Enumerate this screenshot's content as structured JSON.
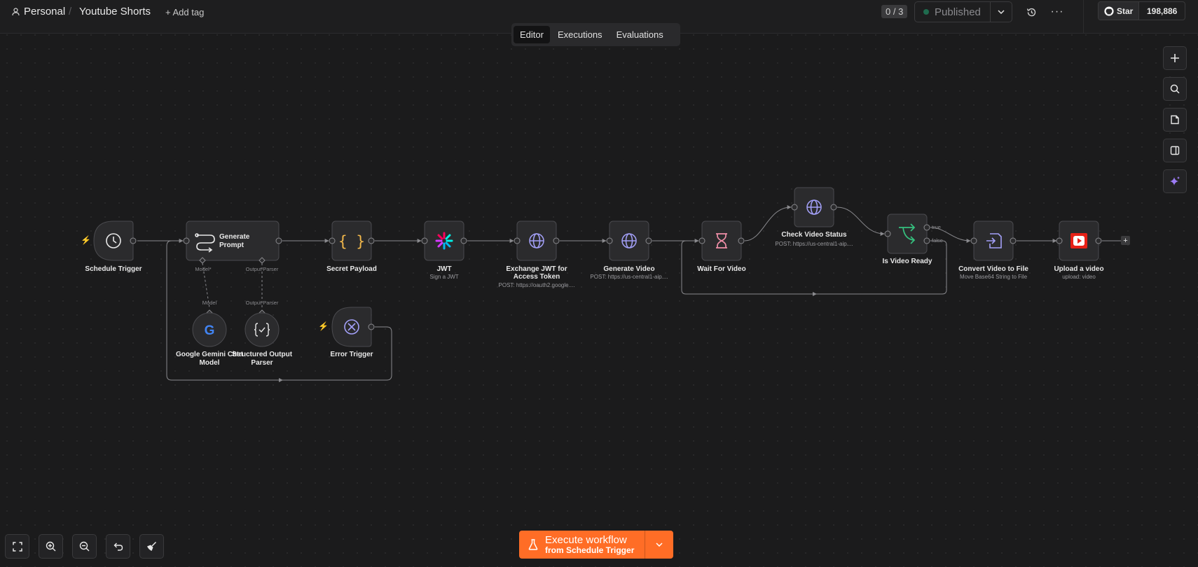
{
  "header": {
    "project": "Personal",
    "separator": "/",
    "workflow_title": "Youtube Shorts",
    "add_tag": "+ Add tag",
    "counter": "0 / 3",
    "publish_label": "Published",
    "more": "···",
    "github_star": "Star",
    "github_count": "198,886"
  },
  "tabs": [
    "Editor",
    "Executions",
    "Evaluations"
  ],
  "active_tab": "Editor",
  "nodes": {
    "schedule_trigger": {
      "label": "Schedule Trigger",
      "icon": "clock-icon"
    },
    "generate_prompt": {
      "label1": "Generate",
      "label2": "Prompt",
      "port_model": "Model*",
      "port_parser": "Output Parser",
      "icon": "route-icon"
    },
    "gemini_model": {
      "label1": "Google Gemini Chat",
      "label2": "Model",
      "port": "Model",
      "icon": "google-icon"
    },
    "output_parser": {
      "label1": "Structured Output",
      "label2": "Parser",
      "port": "Output Parser",
      "icon": "braces-check-icon"
    },
    "secret_payload": {
      "label": "Secret Payload",
      "icon": "braces-icon"
    },
    "jwt": {
      "label": "JWT",
      "sub": "Sign a JWT",
      "icon": "jwt-icon"
    },
    "exchange_jwt": {
      "label1": "Exchange JWT for",
      "label2": "Access Token",
      "sub": "POST: https://oauth2.google....",
      "icon": "globe-icon"
    },
    "generate_video": {
      "label": "Generate Video",
      "sub": "POST: https://us-central1-aip....",
      "icon": "globe-icon"
    },
    "wait_for_video": {
      "label": "Wait For Video",
      "icon": "hourglass-icon"
    },
    "check_video_status": {
      "label": "Check Video Status",
      "sub": "POST: https://us-central1-aip....",
      "icon": "globe-icon"
    },
    "is_video_ready": {
      "label": "Is Video Ready",
      "branch_true": "true",
      "branch_false": "false",
      "icon": "if-branch-icon"
    },
    "convert_video": {
      "label": "Convert Video to File",
      "sub": "Move Base64 String to File",
      "icon": "file-convert-icon"
    },
    "upload_video": {
      "label": "Upload a video",
      "sub": "upload: video",
      "icon": "youtube-icon"
    },
    "error_trigger": {
      "label": "Error Trigger",
      "icon": "error-circle-icon"
    }
  },
  "execute": {
    "title": "Execute workflow",
    "subtitle": "from Schedule Trigger"
  },
  "colors": {
    "accent": "#ff6d26",
    "canvas": "#1b1b1c",
    "node_fill": "#2b2b2d",
    "node_stroke": "#4a4a4e",
    "edge": "#8a8a8e"
  }
}
